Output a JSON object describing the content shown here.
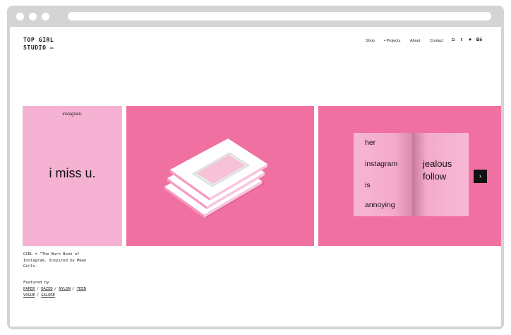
{
  "site": {
    "logo_line1": "TOP GIRL",
    "logo_line2": "STUDIO —"
  },
  "nav": {
    "items": [
      {
        "label": "Shop"
      },
      {
        "label": "• Projects"
      },
      {
        "label": "About"
      },
      {
        "label": "Contact"
      }
    ],
    "social": [
      {
        "icon": "instagram-icon",
        "glyph": "◘"
      },
      {
        "icon": "tumblr-icon",
        "glyph": "t"
      },
      {
        "icon": "twitter-icon",
        "glyph": "♥"
      },
      {
        "icon": "behance-icon",
        "glyph": "Bē"
      }
    ]
  },
  "slides": {
    "panel1_small": "instagram,",
    "panel1_big": "i miss u.",
    "magazine_left": [
      "her",
      "instagram",
      "is",
      "annoying"
    ],
    "magazine_right": [
      "jealous",
      "follow"
    ],
    "next_arrow": "›"
  },
  "caption": {
    "line1": "GIRL = \"The Burn Book of",
    "line2": "Instagram. Inspired by Mean",
    "line3": "Girls."
  },
  "featured": {
    "label": "Featured by",
    "links_row1": [
      "PAPER",
      "DAZED",
      "NYLON",
      "TEEN"
    ],
    "links_row2": [
      "VOGUE",
      "GALORE"
    ]
  },
  "colors": {
    "pink_light": "#f5b2d2",
    "pink_hot": "#f070a2"
  }
}
